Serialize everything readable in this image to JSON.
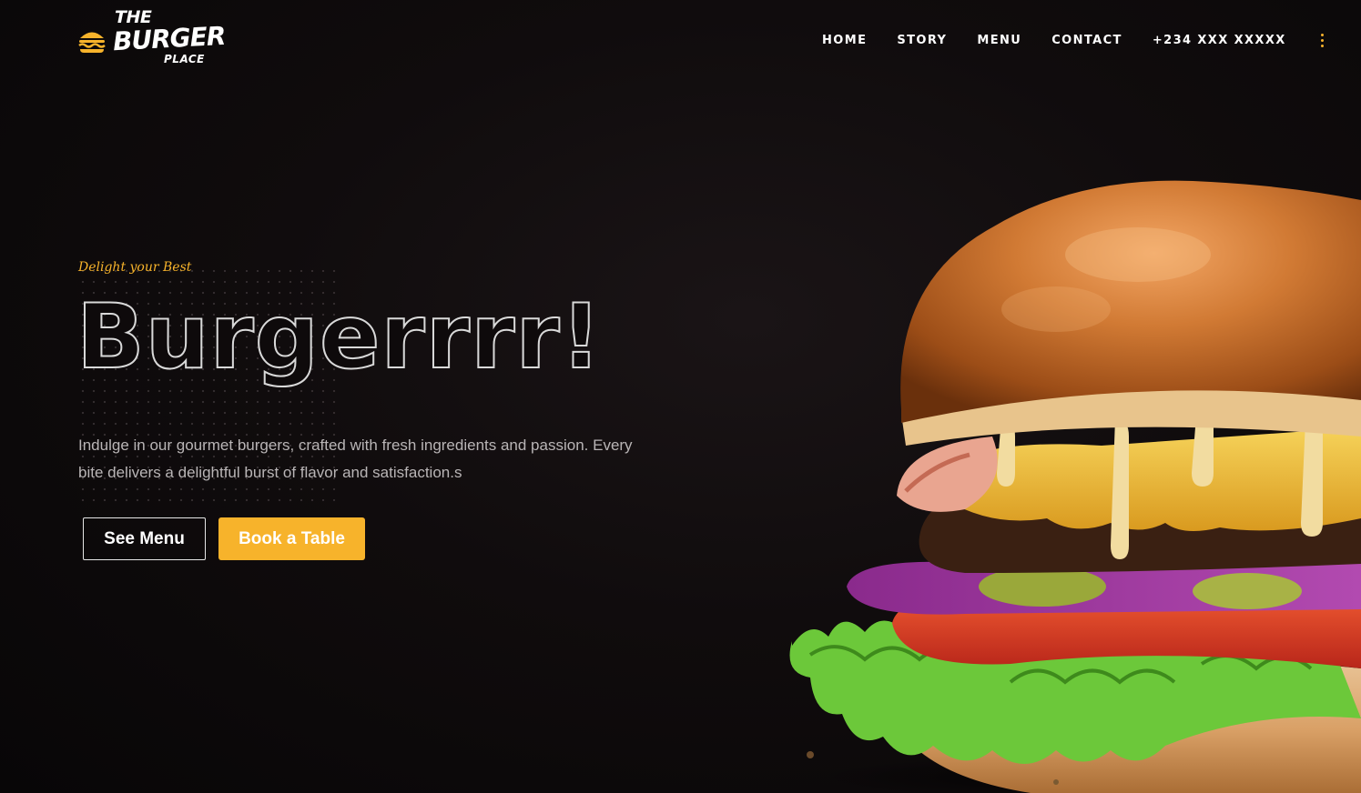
{
  "brand": {
    "the": "THE",
    "burger": "BURGER",
    "place": "PLACE",
    "accent_color": "#f7b32b"
  },
  "nav": {
    "items": [
      {
        "label": "HOME"
      },
      {
        "label": "STORY"
      },
      {
        "label": "MENU"
      },
      {
        "label": "CONTACT"
      }
    ],
    "phone": "+234 XXX XXXXX",
    "more_icon": "kebab-menu-icon"
  },
  "hero": {
    "tagline": "Delight your Best",
    "headline": "Burgerrrr!",
    "description": "Indulge in our gourmet burgers, crafted with fresh ingredients and passion. Every bite delivers a delightful burst of flavor and satisfaction.s",
    "buttons": {
      "see_menu": "See Menu",
      "book_table": "Book a Table"
    },
    "image": "burger-photo"
  }
}
